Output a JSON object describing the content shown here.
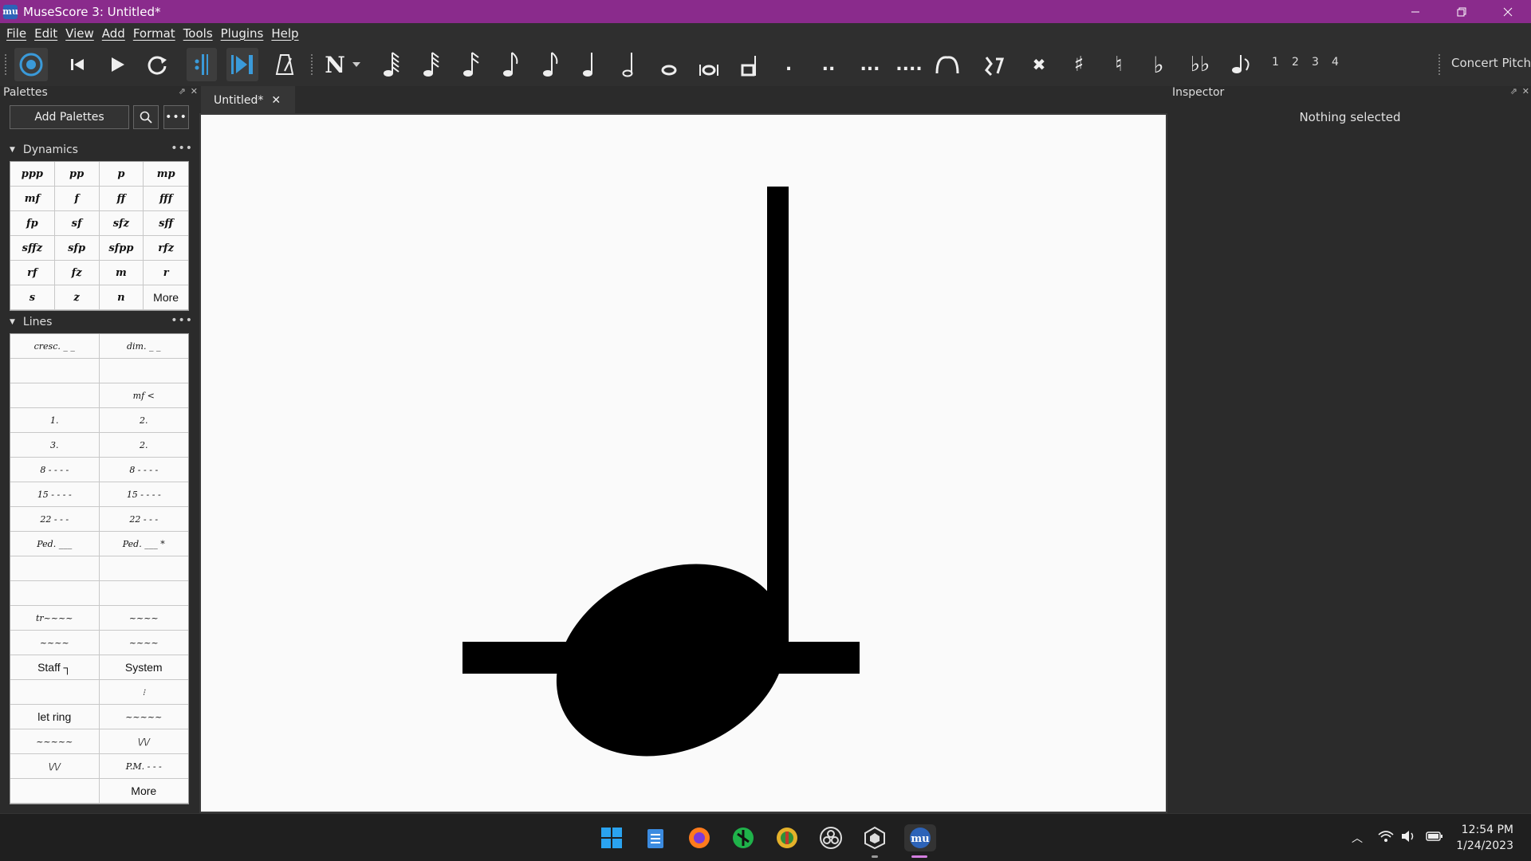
{
  "window": {
    "title": "MuseScore 3: Untitled*",
    "app_icon_text": "mu"
  },
  "menu": [
    "File",
    "Edit",
    "View",
    "Add",
    "Format",
    "Tools",
    "Plugins",
    "Help"
  ],
  "toolbar": {
    "voices": [
      "1",
      "2",
      "3",
      "4"
    ],
    "concert_pitch": "Concert Pitch",
    "dots": [
      ".",
      "..",
      "...",
      "...."
    ]
  },
  "palettes": {
    "title": "Palettes",
    "add_label": "Add Palettes",
    "dynamics": {
      "title": "Dynamics",
      "cells": [
        "ppp",
        "pp",
        "p",
        "mp",
        "mf",
        "f",
        "ff",
        "fff",
        "fp",
        "sf",
        "sfz",
        "sff",
        "sffz",
        "sfp",
        "sfpp",
        "rfz",
        "rf",
        "fz",
        "m",
        "r",
        "s",
        "z",
        "n",
        "More"
      ]
    },
    "lines": {
      "title": "Lines",
      "cells": [
        "cresc. _ _",
        "dim. _ _",
        "",
        "",
        "",
        "mf <",
        "1.",
        "2.",
        "3.",
        "2.",
        "8 - - - -",
        "8 - - - -",
        "15 - - - -",
        "15 - - - -",
        "22 - - -",
        "22 - - -",
        "Ped. ___",
        "Ped. ___ *",
        "",
        "",
        "",
        "",
        "tr~~~~",
        "~~~~",
        "~~~~",
        "~~~~",
        "Staff ┐",
        "System",
        "",
        "⁝",
        "let ring",
        "~~~~~",
        "~~~~~",
        "\\/\\/",
        "\\/\\/",
        "P.M. - - -",
        "",
        "More"
      ]
    }
  },
  "document": {
    "tab_label": "Untitled*"
  },
  "inspector": {
    "title": "Inspector",
    "empty_text": "Nothing selected"
  },
  "taskbar": {
    "time": "12:54 PM",
    "date": "1/24/2023"
  },
  "colors": {
    "titlebar": "#8a2b8c",
    "accent": "#3a9ad9",
    "panel": "#2b2b2b"
  }
}
